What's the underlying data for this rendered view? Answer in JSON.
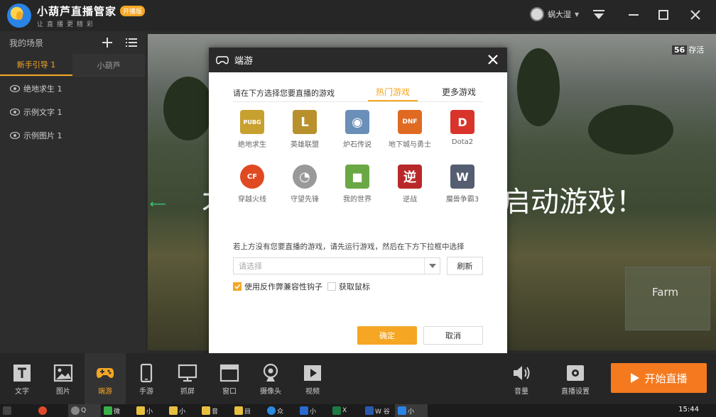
{
  "app": {
    "title": "小葫芦直播管家",
    "badge": "开播版",
    "slogan": "让直播更精彩",
    "user_name": "蜗大湿"
  },
  "sidebar": {
    "header": "我的场景",
    "tabs": [
      {
        "label": "新手引导 1",
        "active": true
      },
      {
        "label": "小葫芦",
        "active": false
      }
    ],
    "sources": [
      {
        "label": "绝地求生 1"
      },
      {
        "label": "示例文字 1"
      },
      {
        "label": "示例图片 1"
      }
    ]
  },
  "preview": {
    "overlay_left": "才",
    "overlay_right": "启动游戏！",
    "fps_value": "56",
    "fps_suffix": "存活",
    "minimap_label": "Farm"
  },
  "modal": {
    "title": "端游",
    "prompt": "请在下方选择您要直播的游戏",
    "tabs": [
      {
        "label": "热门游戏",
        "active": true
      },
      {
        "label": "更多游戏",
        "active": false
      }
    ],
    "games": [
      {
        "label": "绝地求生",
        "icon": "pubg-icon",
        "color": "#c8a030",
        "glyph": "PUBG"
      },
      {
        "label": "英雄联盟",
        "icon": "lol-icon",
        "color": "#b8902c",
        "glyph": "L"
      },
      {
        "label": "炉石传说",
        "icon": "hearthstone-icon",
        "color": "#6a8fb8",
        "glyph": "◉"
      },
      {
        "label": "地下城与勇士",
        "icon": "dnf-icon",
        "color": "#e06a22",
        "glyph": "DNF"
      },
      {
        "label": "Dota2",
        "icon": "dota2-icon",
        "color": "#d9342b",
        "glyph": "D"
      },
      {
        "label": "穿越火线",
        "icon": "cf-icon",
        "color": "#e04a22",
        "glyph": "CF"
      },
      {
        "label": "守望先锋",
        "icon": "overwatch-icon",
        "color": "#999999",
        "glyph": "◔"
      },
      {
        "label": "我的世界",
        "icon": "minecraft-icon",
        "color": "#6aa846",
        "glyph": "■"
      },
      {
        "label": "逆战",
        "icon": "nizhan-icon",
        "color": "#b8282a",
        "glyph": "逆"
      },
      {
        "label": "魔兽争霸3",
        "icon": "warcraft3-icon",
        "color": "#555d70",
        "glyph": "W"
      }
    ],
    "manual_hint": "若上方没有您要直播的游戏，请先运行游戏，然后在下方下拉框中选择",
    "select_placeholder": "请选择",
    "refresh_label": "刷新",
    "checkbox_anticheat": {
      "label": "使用反作弊兼容性钩子",
      "checked": true
    },
    "checkbox_mouse": {
      "label": "获取鼠标",
      "checked": false
    },
    "ok_label": "确定",
    "cancel_label": "取消"
  },
  "toolbar": {
    "tools": [
      {
        "label": "文字",
        "icon": "text-icon",
        "active": false
      },
      {
        "label": "图片",
        "icon": "image-icon",
        "active": false
      },
      {
        "label": "端游",
        "icon": "gamepad-icon",
        "active": true
      },
      {
        "label": "手游",
        "icon": "phone-icon",
        "active": false
      },
      {
        "label": "抓屏",
        "icon": "monitor-icon",
        "active": false
      },
      {
        "label": "窗口",
        "icon": "window-icon",
        "active": false
      },
      {
        "label": "摄像头",
        "icon": "camera-icon",
        "active": false
      },
      {
        "label": "视频",
        "icon": "video-icon",
        "active": false
      }
    ],
    "volume_label": "音量",
    "settings_label": "直播设置",
    "start_label": "开始直播"
  },
  "taskbar": {
    "items": [
      "",
      "",
      "Q",
      "微",
      "小",
      "小",
      "音",
      "目",
      "众",
      "小",
      "X",
      "W 谷",
      "小"
    ],
    "clock": "15:44"
  },
  "colors": {
    "accent": "#f5a623",
    "start": "#f57a1f"
  }
}
